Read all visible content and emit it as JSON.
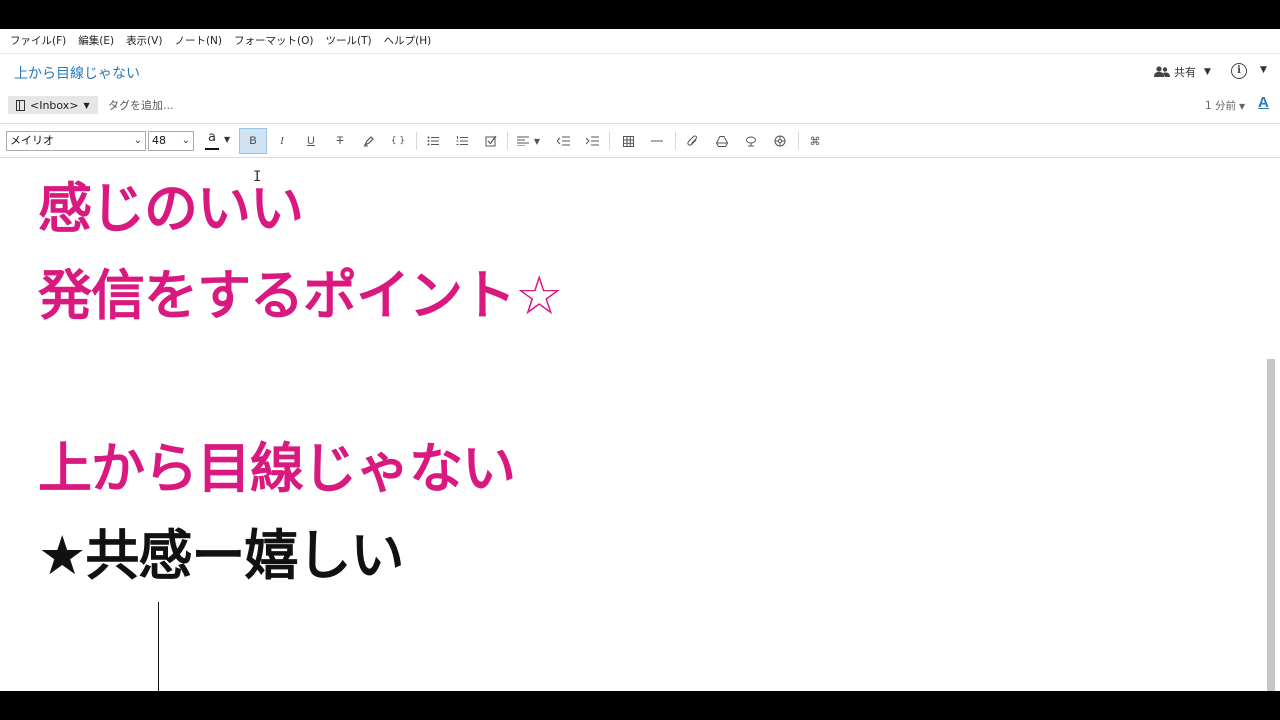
{
  "menu": [
    "ファイル(F)",
    "編集(E)",
    "表示(V)",
    "ノート(N)",
    "フォーマット(O)",
    "ツール(T)",
    "ヘルプ(H)"
  ],
  "note": {
    "title": "上から目線じゃない",
    "share_label": "共有",
    "notebook": "<Inbox>",
    "tag_placeholder": "タグを追加...",
    "updated": "1 分前"
  },
  "toolbar": {
    "font": "メイリオ",
    "size": "48",
    "text_color_glyph": "a",
    "bold_glyph": "B",
    "italic_glyph": "I",
    "underline_glyph": "U",
    "strike_glyph": "T",
    "code_glyph": "{ }",
    "shortcut_glyph": "⌘"
  },
  "content": {
    "line1": "感じのいい",
    "line2": "発信をするポイント☆",
    "line3": "上から目線じゃない",
    "line4": "★共感ー嬉しい"
  },
  "colors": {
    "accent": "#2a7ab9",
    "pink_text": "#d9197f",
    "active_button": "#cfe3f2"
  }
}
